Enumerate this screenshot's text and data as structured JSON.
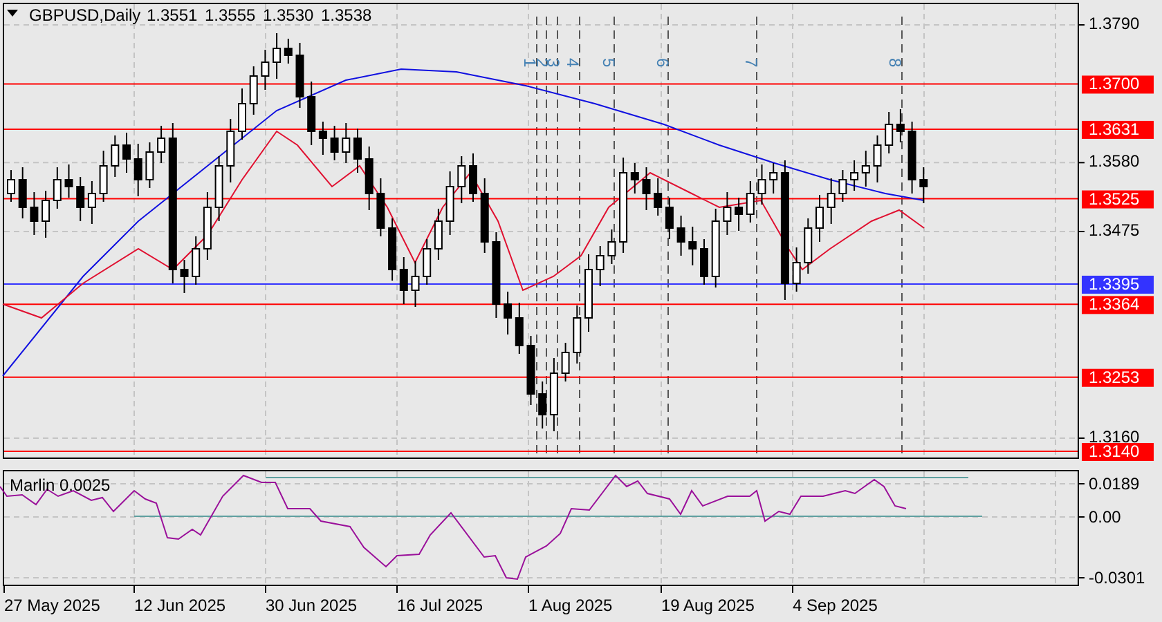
{
  "header": {
    "symbol": "GBPUSD,Daily",
    "ohlc": [
      "1.3551",
      "1.3555",
      "1.3530",
      "1.3538"
    ]
  },
  "price_axis": {
    "ticks": [
      "1.3790",
      "1.3580",
      "1.3475",
      "1.3160"
    ]
  },
  "levels": [
    {
      "price": "1.3700",
      "color": "#ff0000"
    },
    {
      "price": "1.3631",
      "color": "#ff0000"
    },
    {
      "price": "1.3525",
      "color": "#ff0000"
    },
    {
      "price": "1.3395",
      "color": "#3333ff"
    },
    {
      "price": "1.3364",
      "color": "#ff0000"
    },
    {
      "price": "1.3253",
      "color": "#ff0000"
    },
    {
      "price": "1.3140",
      "color": "#ff0000"
    }
  ],
  "markers": [
    {
      "label": "1"
    },
    {
      "label": "2"
    },
    {
      "label": "3"
    },
    {
      "label": "4"
    },
    {
      "label": "5"
    },
    {
      "label": "6"
    },
    {
      "label": "7"
    },
    {
      "label": "8"
    }
  ],
  "indicator": {
    "label": "Marlin 0.0025",
    "ticks": [
      "0.0189",
      "0.00",
      "-0.0301"
    ]
  },
  "time_axis": [
    "27 May 2025",
    "12 Jun 2025",
    "30 Jun 2025",
    "16 Jul 2025",
    "1 Aug 2025",
    "19 Aug 2025",
    "4 Sep 2025"
  ]
}
